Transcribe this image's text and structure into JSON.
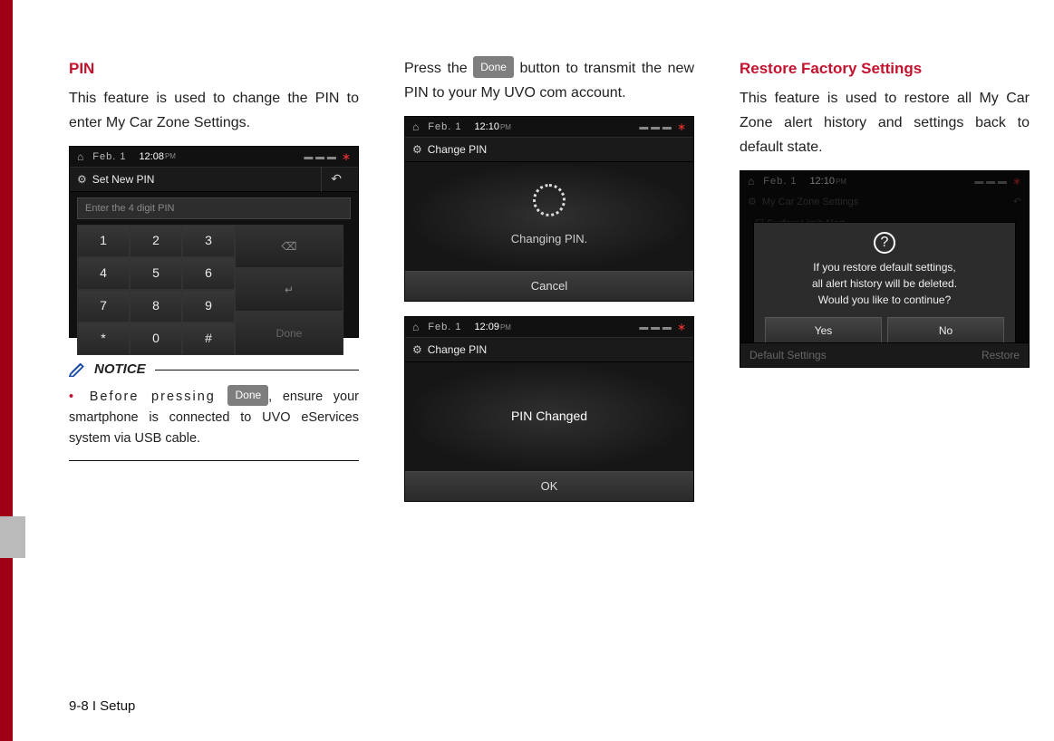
{
  "footer": "9-8 I Setup",
  "buttons": {
    "done": "Done"
  },
  "col1": {
    "heading": "PIN",
    "body": "This feature is used to change the PIN to enter My Car Zone Settings.",
    "notice_label": "NOTICE",
    "notice_before": "Before pressing ",
    "notice_after": ", ensure your smartphone is connected to UVO eServices system via USB cable.",
    "shot": {
      "date": "Feb.  1",
      "time": "12:08",
      "pm": "PM",
      "title": "Set New PIN",
      "placeholder": "Enter the 4 digit PIN",
      "keys": [
        "1",
        "2",
        "3",
        "4",
        "5",
        "6",
        "7",
        "8",
        "9",
        "*",
        "0",
        "#"
      ],
      "backspace": "⌫",
      "enter": "↵",
      "done": "Done"
    }
  },
  "col2": {
    "body_before": "Press the ",
    "body_after": " button to transmit the new PIN to your My UVO com account.",
    "shot1": {
      "date": "Feb.  1",
      "time": "12:10",
      "pm": "PM",
      "title": "Change PIN",
      "msg": "Changing PIN.",
      "cancel": "Cancel"
    },
    "shot2": {
      "date": "Feb.  1",
      "time": "12:09",
      "pm": "PM",
      "title": "Change PIN",
      "msg": "PIN Changed",
      "ok": "OK"
    }
  },
  "col3": {
    "heading": "Restore Factory Settings",
    "body": "This feature is used to restore all My Car Zone alert history and settings back to default state.",
    "shot": {
      "date": "Feb.  1",
      "time": "12:10",
      "pm": "PM",
      "title": "My Car Zone Settings",
      "line": "Curfew Limit Alert",
      "dialog_lines": [
        "If you restore default settings,",
        "all alert history will be deleted.",
        "Would you like to continue?"
      ],
      "yes": "Yes",
      "no": "No",
      "bottom_left": "Default Settings",
      "bottom_right": "Restore"
    }
  }
}
